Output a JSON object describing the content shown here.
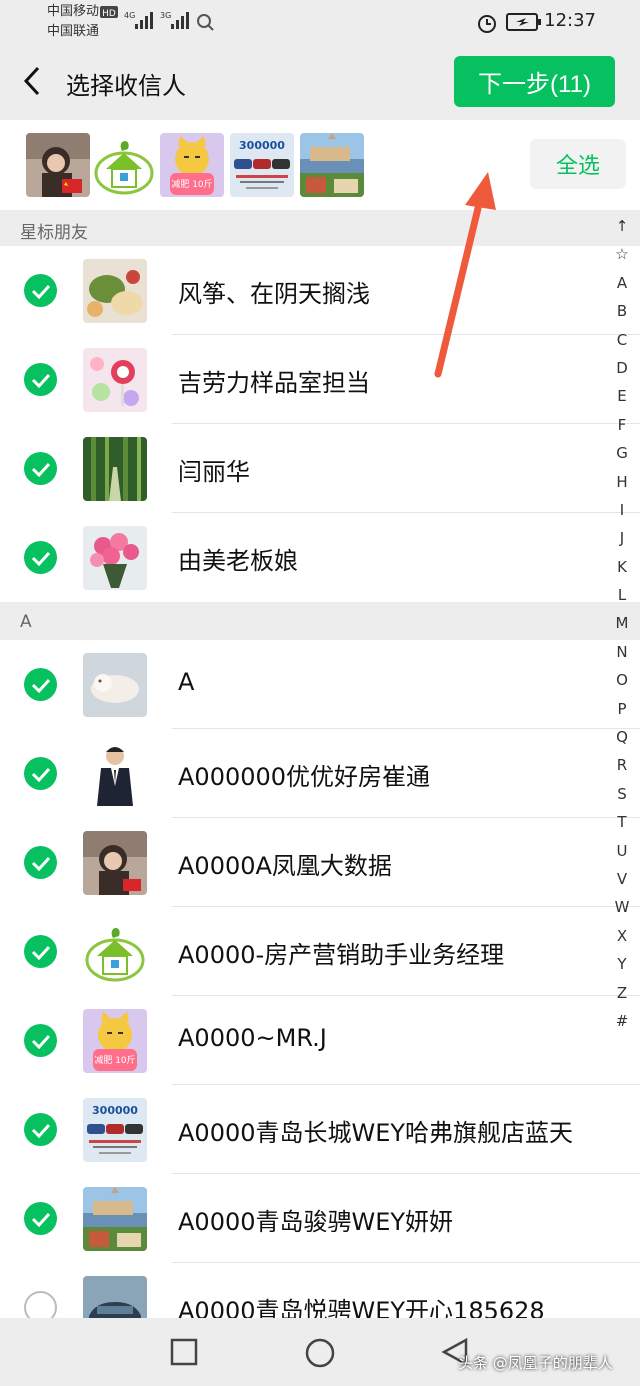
{
  "status": {
    "carrier1": "中国移动",
    "carrier2": "中国联通",
    "hd": "HD",
    "net1": "4G",
    "net2": "3G",
    "time": "12:37"
  },
  "header": {
    "title": "选择收信人",
    "next_label": "下一步(11)"
  },
  "selected_strip": {
    "select_all_label": "全选",
    "avatar_icons": [
      "girl-photo-icon",
      "green-house-logo-icon",
      "cat-cartoon-icon",
      "car-poster-icon",
      "city-photo-icon"
    ],
    "cat_caption": "减肥 10斤",
    "car_caption": "300000"
  },
  "sections": [
    {
      "title": "星标朋友"
    },
    {
      "title": "A"
    }
  ],
  "contacts": [
    {
      "name": "风筝、在阴天搁浅",
      "checked": true,
      "avatar": "food-photo-icon"
    },
    {
      "name": "吉劳力样品室担当",
      "checked": true,
      "avatar": "candy-photo-icon"
    },
    {
      "name": "闫丽华",
      "checked": true,
      "avatar": "bamboo-photo-icon"
    },
    {
      "name": "由美老板娘",
      "checked": true,
      "avatar": "flower-bouquet-icon"
    },
    {
      "name": "A",
      "checked": true,
      "avatar": "kitten-photo-icon"
    },
    {
      "name": "A000000优优好房崔通",
      "checked": true,
      "avatar": "man-in-suit-icon"
    },
    {
      "name": "A0000A凤凰大数据",
      "checked": true,
      "avatar": "girl-photo-icon"
    },
    {
      "name": "A0000-房产营销助手业务经理",
      "checked": true,
      "avatar": "green-house-logo-icon"
    },
    {
      "name": "A0000~MR.J",
      "checked": true,
      "avatar": "cat-cartoon-icon"
    },
    {
      "name": "A0000青岛长城WEY哈弗旗舰店蓝天",
      "checked": true,
      "avatar": "car-poster-icon"
    },
    {
      "name": "A0000青岛骏骋WEY妍妍",
      "checked": true,
      "avatar": "city-photo-icon"
    },
    {
      "name": "A0000青岛悦骋WEY开心185628",
      "checked": false,
      "avatar": "car-photo-icon"
    }
  ],
  "index_bar": [
    "↑",
    "☆",
    "A",
    "B",
    "C",
    "D",
    "E",
    "F",
    "G",
    "H",
    "I",
    "J",
    "K",
    "L",
    "M",
    "N",
    "O",
    "P",
    "Q",
    "R",
    "S",
    "T",
    "U",
    "V",
    "W",
    "X",
    "Y",
    "Z",
    "#"
  ],
  "watermark": "头条 @凤凰子的朋辈人",
  "colors": {
    "accent": "#07c160",
    "annotation_arrow": "#f05a3c"
  }
}
